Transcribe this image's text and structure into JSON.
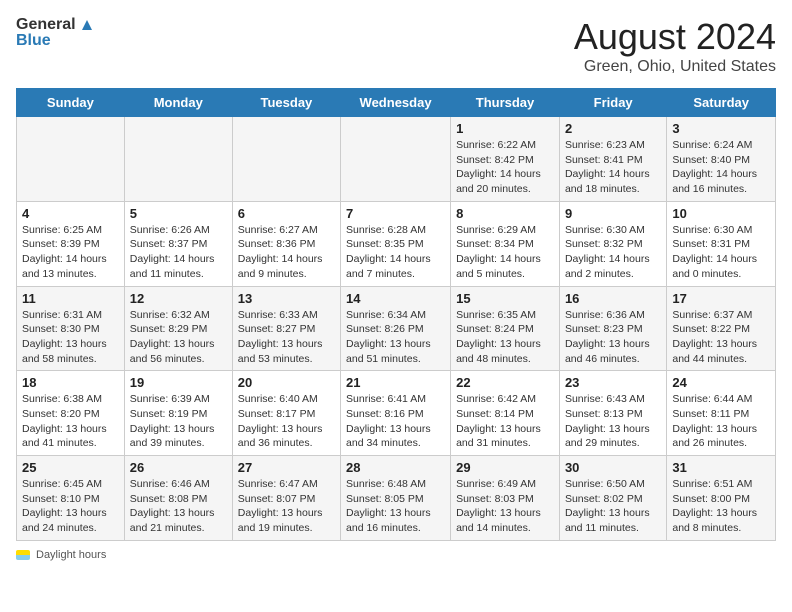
{
  "header": {
    "logo_line1": "General",
    "logo_line2": "Blue",
    "title": "August 2024",
    "subtitle": "Green, Ohio, United States"
  },
  "days_of_week": [
    "Sunday",
    "Monday",
    "Tuesday",
    "Wednesday",
    "Thursday",
    "Friday",
    "Saturday"
  ],
  "weeks": [
    [
      {
        "num": "",
        "info": ""
      },
      {
        "num": "",
        "info": ""
      },
      {
        "num": "",
        "info": ""
      },
      {
        "num": "",
        "info": ""
      },
      {
        "num": "1",
        "info": "Sunrise: 6:22 AM\nSunset: 8:42 PM\nDaylight: 14 hours and 20 minutes."
      },
      {
        "num": "2",
        "info": "Sunrise: 6:23 AM\nSunset: 8:41 PM\nDaylight: 14 hours and 18 minutes."
      },
      {
        "num": "3",
        "info": "Sunrise: 6:24 AM\nSunset: 8:40 PM\nDaylight: 14 hours and 16 minutes."
      }
    ],
    [
      {
        "num": "4",
        "info": "Sunrise: 6:25 AM\nSunset: 8:39 PM\nDaylight: 14 hours and 13 minutes."
      },
      {
        "num": "5",
        "info": "Sunrise: 6:26 AM\nSunset: 8:37 PM\nDaylight: 14 hours and 11 minutes."
      },
      {
        "num": "6",
        "info": "Sunrise: 6:27 AM\nSunset: 8:36 PM\nDaylight: 14 hours and 9 minutes."
      },
      {
        "num": "7",
        "info": "Sunrise: 6:28 AM\nSunset: 8:35 PM\nDaylight: 14 hours and 7 minutes."
      },
      {
        "num": "8",
        "info": "Sunrise: 6:29 AM\nSunset: 8:34 PM\nDaylight: 14 hours and 5 minutes."
      },
      {
        "num": "9",
        "info": "Sunrise: 6:30 AM\nSunset: 8:32 PM\nDaylight: 14 hours and 2 minutes."
      },
      {
        "num": "10",
        "info": "Sunrise: 6:30 AM\nSunset: 8:31 PM\nDaylight: 14 hours and 0 minutes."
      }
    ],
    [
      {
        "num": "11",
        "info": "Sunrise: 6:31 AM\nSunset: 8:30 PM\nDaylight: 13 hours and 58 minutes."
      },
      {
        "num": "12",
        "info": "Sunrise: 6:32 AM\nSunset: 8:29 PM\nDaylight: 13 hours and 56 minutes."
      },
      {
        "num": "13",
        "info": "Sunrise: 6:33 AM\nSunset: 8:27 PM\nDaylight: 13 hours and 53 minutes."
      },
      {
        "num": "14",
        "info": "Sunrise: 6:34 AM\nSunset: 8:26 PM\nDaylight: 13 hours and 51 minutes."
      },
      {
        "num": "15",
        "info": "Sunrise: 6:35 AM\nSunset: 8:24 PM\nDaylight: 13 hours and 48 minutes."
      },
      {
        "num": "16",
        "info": "Sunrise: 6:36 AM\nSunset: 8:23 PM\nDaylight: 13 hours and 46 minutes."
      },
      {
        "num": "17",
        "info": "Sunrise: 6:37 AM\nSunset: 8:22 PM\nDaylight: 13 hours and 44 minutes."
      }
    ],
    [
      {
        "num": "18",
        "info": "Sunrise: 6:38 AM\nSunset: 8:20 PM\nDaylight: 13 hours and 41 minutes."
      },
      {
        "num": "19",
        "info": "Sunrise: 6:39 AM\nSunset: 8:19 PM\nDaylight: 13 hours and 39 minutes."
      },
      {
        "num": "20",
        "info": "Sunrise: 6:40 AM\nSunset: 8:17 PM\nDaylight: 13 hours and 36 minutes."
      },
      {
        "num": "21",
        "info": "Sunrise: 6:41 AM\nSunset: 8:16 PM\nDaylight: 13 hours and 34 minutes."
      },
      {
        "num": "22",
        "info": "Sunrise: 6:42 AM\nSunset: 8:14 PM\nDaylight: 13 hours and 31 minutes."
      },
      {
        "num": "23",
        "info": "Sunrise: 6:43 AM\nSunset: 8:13 PM\nDaylight: 13 hours and 29 minutes."
      },
      {
        "num": "24",
        "info": "Sunrise: 6:44 AM\nSunset: 8:11 PM\nDaylight: 13 hours and 26 minutes."
      }
    ],
    [
      {
        "num": "25",
        "info": "Sunrise: 6:45 AM\nSunset: 8:10 PM\nDaylight: 13 hours and 24 minutes."
      },
      {
        "num": "26",
        "info": "Sunrise: 6:46 AM\nSunset: 8:08 PM\nDaylight: 13 hours and 21 minutes."
      },
      {
        "num": "27",
        "info": "Sunrise: 6:47 AM\nSunset: 8:07 PM\nDaylight: 13 hours and 19 minutes."
      },
      {
        "num": "28",
        "info": "Sunrise: 6:48 AM\nSunset: 8:05 PM\nDaylight: 13 hours and 16 minutes."
      },
      {
        "num": "29",
        "info": "Sunrise: 6:49 AM\nSunset: 8:03 PM\nDaylight: 13 hours and 14 minutes."
      },
      {
        "num": "30",
        "info": "Sunrise: 6:50 AM\nSunset: 8:02 PM\nDaylight: 13 hours and 11 minutes."
      },
      {
        "num": "31",
        "info": "Sunrise: 6:51 AM\nSunset: 8:00 PM\nDaylight: 13 hours and 8 minutes."
      }
    ]
  ],
  "footer": {
    "label": "Daylight hours"
  }
}
